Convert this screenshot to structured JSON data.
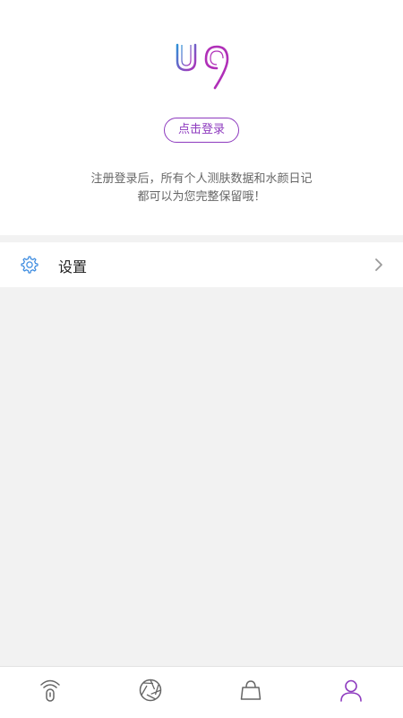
{
  "profile": {
    "logo_icon": "u9-logo",
    "login_button_label": "点击登录",
    "hint_line1": "注册登录后，所有个人测肤数据和水颜日记",
    "hint_line2": "都可以为您完整保留哦！"
  },
  "settings": {
    "label": "设置",
    "icon": "gear-icon",
    "chevron": "chevron-right-icon"
  },
  "tabbar": {
    "tabs": [
      {
        "icon": "skin-test-device-icon",
        "active": false
      },
      {
        "icon": "aperture-icon",
        "active": false
      },
      {
        "icon": "shopping-bag-icon",
        "active": false
      },
      {
        "icon": "user-icon",
        "active": true
      }
    ]
  },
  "colors": {
    "accent": "#8e3bbf",
    "logo_blue": "#2f8fd6",
    "icon_gray": "#666666",
    "background": "#f2f2f2"
  }
}
